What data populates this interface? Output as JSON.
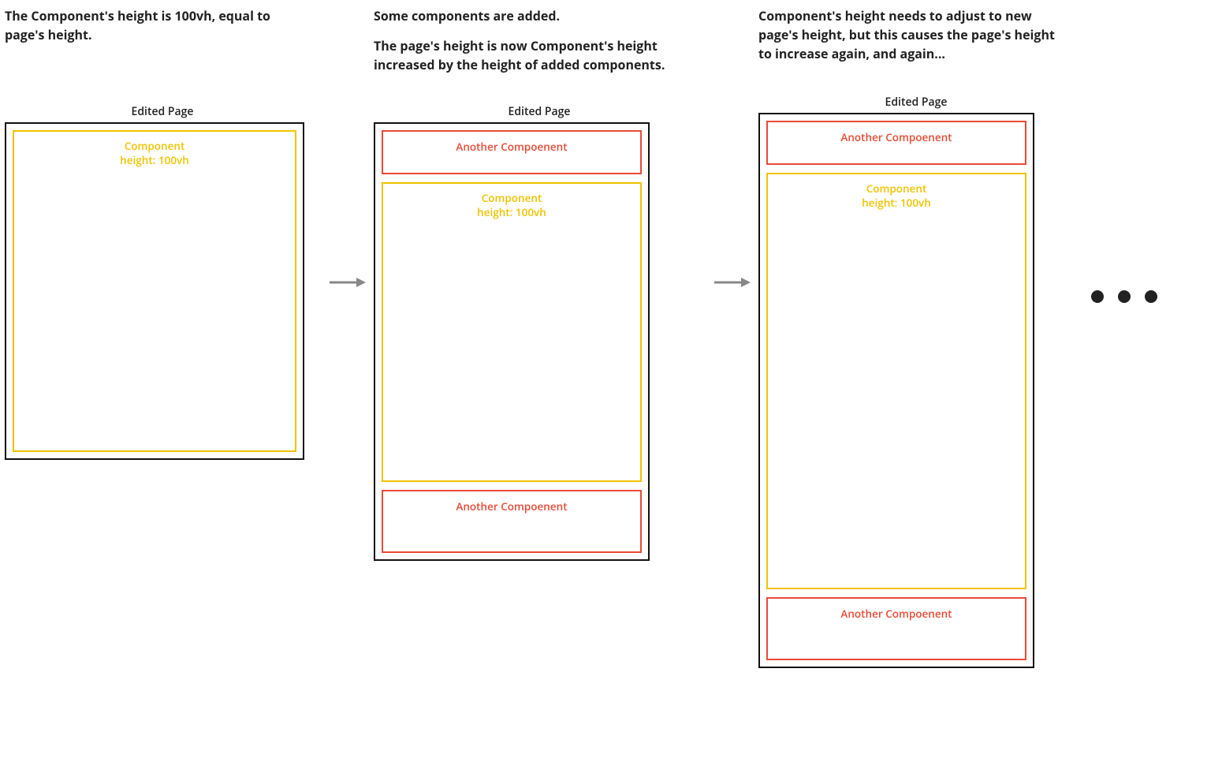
{
  "captions": {
    "step1": "The Component's height is 100vh, equal to page's height.",
    "step2_line1": "Some components are added.",
    "step2_line2": "The page's height is now Component's height increased by the height of added components.",
    "step3": "Component's height needs to adjust to new page's height, but this causes the page's height to increase again, and again..."
  },
  "labels": {
    "edited_page": "Edited Page",
    "component": "Component",
    "component_height": "height: 100vh",
    "another_component": "Another Compoenent"
  }
}
